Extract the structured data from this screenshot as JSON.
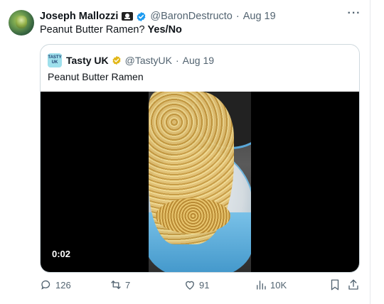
{
  "tweet": {
    "author_name": "Joseph Mallozzi",
    "handle": "@BaronDestructo",
    "separator": "·",
    "date": "Aug 19",
    "text_main": "Peanut Butter Ramen? ",
    "text_bold": "Yes/No",
    "more_label": "···"
  },
  "quote": {
    "avatar_label": "TASTY UK",
    "author_name": "Tasty UK",
    "handle": "@TastyUK",
    "separator": "·",
    "date": "Aug 19",
    "text": "Peanut Butter Ramen",
    "video_timestamp": "0:02"
  },
  "actions": {
    "replies": "126",
    "reposts": "7",
    "likes": "91",
    "views": "10K"
  },
  "colors": {
    "verified_blue": "#1d9bf0",
    "verified_gold": "#e2b719",
    "muted_text": "#536471",
    "border": "#cfd9de"
  }
}
